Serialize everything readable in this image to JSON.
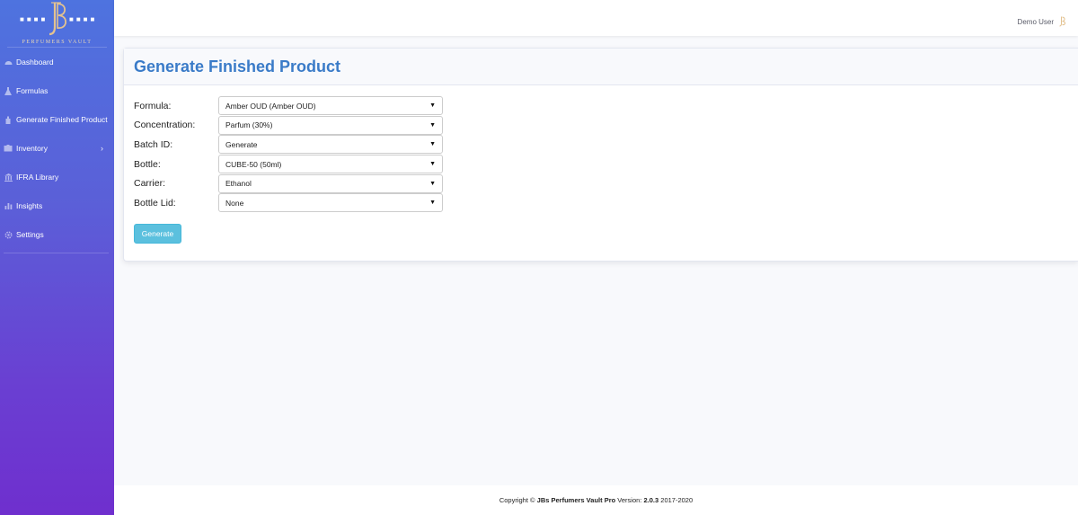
{
  "brand": {
    "tagline": "PERFUMERS VAULT",
    "logo_alt": "JB"
  },
  "sidebar": {
    "items": [
      {
        "label": "Dashboard",
        "icon": "tachometer-icon"
      },
      {
        "label": "Formulas",
        "icon": "flask-icon"
      },
      {
        "label": "Generate Finished Product",
        "icon": "spray-bottle-icon"
      },
      {
        "label": "Inventory",
        "icon": "box-icon",
        "has_submenu": true
      },
      {
        "label": "IFRA Library",
        "icon": "university-icon"
      },
      {
        "label": "Insights",
        "icon": "bar-chart-icon"
      },
      {
        "label": "Settings",
        "icon": "gear-icon"
      }
    ]
  },
  "topbar": {
    "user_name": "Demo User"
  },
  "main": {
    "title": "Generate Finished Product",
    "form": {
      "formula": {
        "label": "Formula:",
        "value": "Amber OUD (Amber OUD)"
      },
      "concentration": {
        "label": "Concentration:",
        "value": "Parfum (30%)"
      },
      "batch_id": {
        "label": "Batch ID:",
        "value": "Generate"
      },
      "bottle": {
        "label": "Bottle:",
        "value": "CUBE-50 (50ml)"
      },
      "carrier": {
        "label": "Carrier:",
        "value": "Ethanol"
      },
      "bottle_lid": {
        "label": "Bottle Lid:",
        "value": "None"
      }
    },
    "generate_button": "Generate"
  },
  "footer": {
    "prefix": "Copyright ©",
    "product": "JBs Perfumers Vault Pro",
    "version_label": "Version:",
    "version": "2.0.3",
    "years": "2017-2020"
  },
  "colors": {
    "sidebar_top": "#4e73df",
    "sidebar_bottom": "#6f2fce",
    "title": "#3a7bc8",
    "button": "#5bc0de",
    "logo_gold": "#e3c290"
  }
}
